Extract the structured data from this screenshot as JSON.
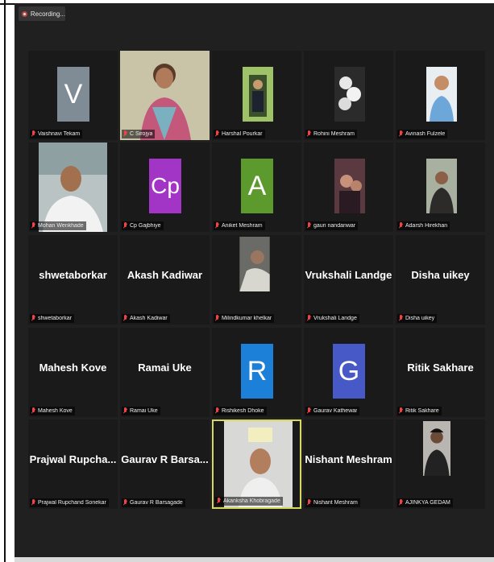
{
  "recording": {
    "text": "Recording..."
  },
  "colors": {
    "background": "#202020",
    "tile": "#1a1a1a",
    "active_border": "#d6d95e",
    "muted_mic": "#e44444"
  },
  "tiles": [
    {
      "label": "Vaishnavi Tekam",
      "avatar": "V",
      "avatar_color": "#7f8c95",
      "kind": "letter"
    },
    {
      "label": "C Sirojya",
      "kind": "video"
    },
    {
      "label": "Harshal Pourkar",
      "kind": "photo"
    },
    {
      "label": "Rohini Meshram",
      "kind": "photo"
    },
    {
      "label": "Avinash Fulzele",
      "kind": "photo"
    },
    {
      "label": "Mohan Wenkhade",
      "kind": "video"
    },
    {
      "label": "Cp Gajbhiye",
      "avatar": "Cp",
      "avatar_color": "#a234c6",
      "kind": "letter"
    },
    {
      "label": "Aniket Meshram",
      "avatar": "A",
      "avatar_color": "#5c9a2e",
      "kind": "letter"
    },
    {
      "label": "gauri nandanwar",
      "kind": "photo"
    },
    {
      "label": "Adarsh Hirekhan",
      "kind": "photo"
    },
    {
      "label": "shwetaborkar",
      "big": "shwetaborkar",
      "kind": "name"
    },
    {
      "label": "Akash Kadiwar",
      "big": "Akash Kadiwar",
      "kind": "name"
    },
    {
      "label": "Milindkumar khelkar",
      "kind": "photo"
    },
    {
      "label": "Vrukshali Landge",
      "big": "Vrukshali Landge",
      "kind": "name"
    },
    {
      "label": "Disha uikey",
      "big": "Disha uikey",
      "kind": "name"
    },
    {
      "label": "Mahesh Kove",
      "big": "Mahesh Kove",
      "kind": "name"
    },
    {
      "label": "Ramai Uke",
      "big": "Ramai Uke",
      "kind": "name"
    },
    {
      "label": "Rishikesh Dhoke",
      "avatar": "R",
      "avatar_color": "#1c7fd8",
      "kind": "letter"
    },
    {
      "label": "Gaurav Kathewar",
      "avatar": "G",
      "avatar_color": "#4758c7",
      "kind": "letter"
    },
    {
      "label": "Ritik Sakhare",
      "big": "Ritik Sakhare",
      "kind": "name"
    },
    {
      "label": "Prajwal Rupchand Sonekar",
      "big": "Prajwal  Rupcha...",
      "kind": "name"
    },
    {
      "label": "Gaurav R Barsagade",
      "big": "Gaurav R Barsa...",
      "kind": "name"
    },
    {
      "label": "Akanksha Khobragade",
      "kind": "video",
      "active": true
    },
    {
      "label": "Nishant Meshram",
      "big": "Nishant Meshram",
      "kind": "name"
    },
    {
      "label": "AJINKYA GEDAM",
      "kind": "photo"
    }
  ]
}
